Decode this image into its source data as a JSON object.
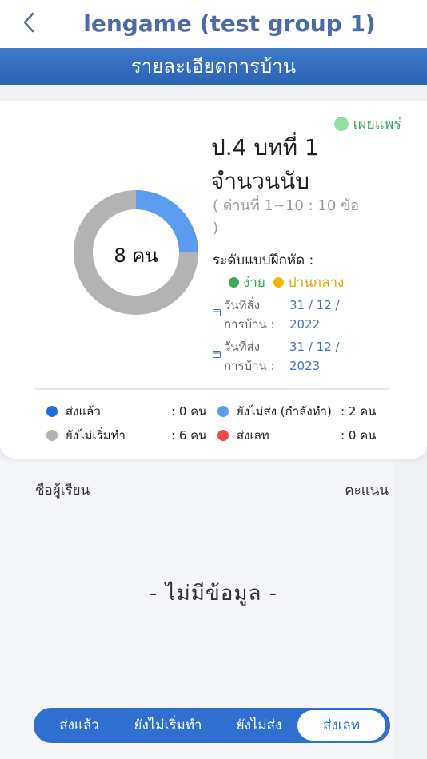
{
  "header": {
    "title": "lengame (test group 1)"
  },
  "sub_header": {
    "title": "รายละเอียดการบ้าน"
  },
  "status": {
    "label": "เผยแพร่"
  },
  "lesson": {
    "title_line1": "ป.4 บทที่ 1",
    "title_line2": "จำนวนนับ",
    "range_line1": "( ด่านที่ 1~10 : 10 ข้อ",
    "range_line2": ")",
    "level_label": "ระดับแบบฝึกหัด :",
    "level_easy": "ง่าย",
    "level_medium": "ปานกลาง"
  },
  "dates": {
    "assigned_label_line1": "วันที่สั่ง",
    "assigned_label_line2": "การบ้าน :",
    "assigned_value_line1": "31 / 12 /",
    "assigned_value_line2": "2022",
    "due_label_line1": "วันที่ส่ง",
    "due_label_line2": "การบ้าน :",
    "due_value_line1": "31 / 12 /",
    "due_value_line2": "2023"
  },
  "donut": {
    "center_label": "8 คน",
    "total": 8,
    "in_progress": 2,
    "not_started": 6
  },
  "legend": {
    "submitted_label": "ส่งแล้ว",
    "submitted_count": ": 0 คน",
    "in_progress_label": "ยังไม่ส่ง (กำลังทำ)",
    "in_progress_count": ": 2 คน",
    "not_started_label": "ยังไม่เริ่มทำ",
    "not_started_count": ": 6 คน",
    "late_label": "ส่งเลท",
    "late_count": ": 0 คน"
  },
  "colors": {
    "submitted": "#1f6fd6",
    "in_progress": "#5b9bf0",
    "not_started": "#b3b3b3",
    "late": "#e84a4f",
    "easy": "#3fa95b",
    "medium": "#f2b705"
  },
  "table": {
    "col_name": "ชื่อผู้เรียน",
    "col_score": "คะแนน",
    "empty": "- ไม่มีข้อมูล -"
  },
  "tabs": [
    "ส่งแล้ว",
    "ยังไม่เริ่มทำ",
    "ยังไม่ส่ง",
    "ส่งเลท"
  ],
  "active_tab": 3
}
